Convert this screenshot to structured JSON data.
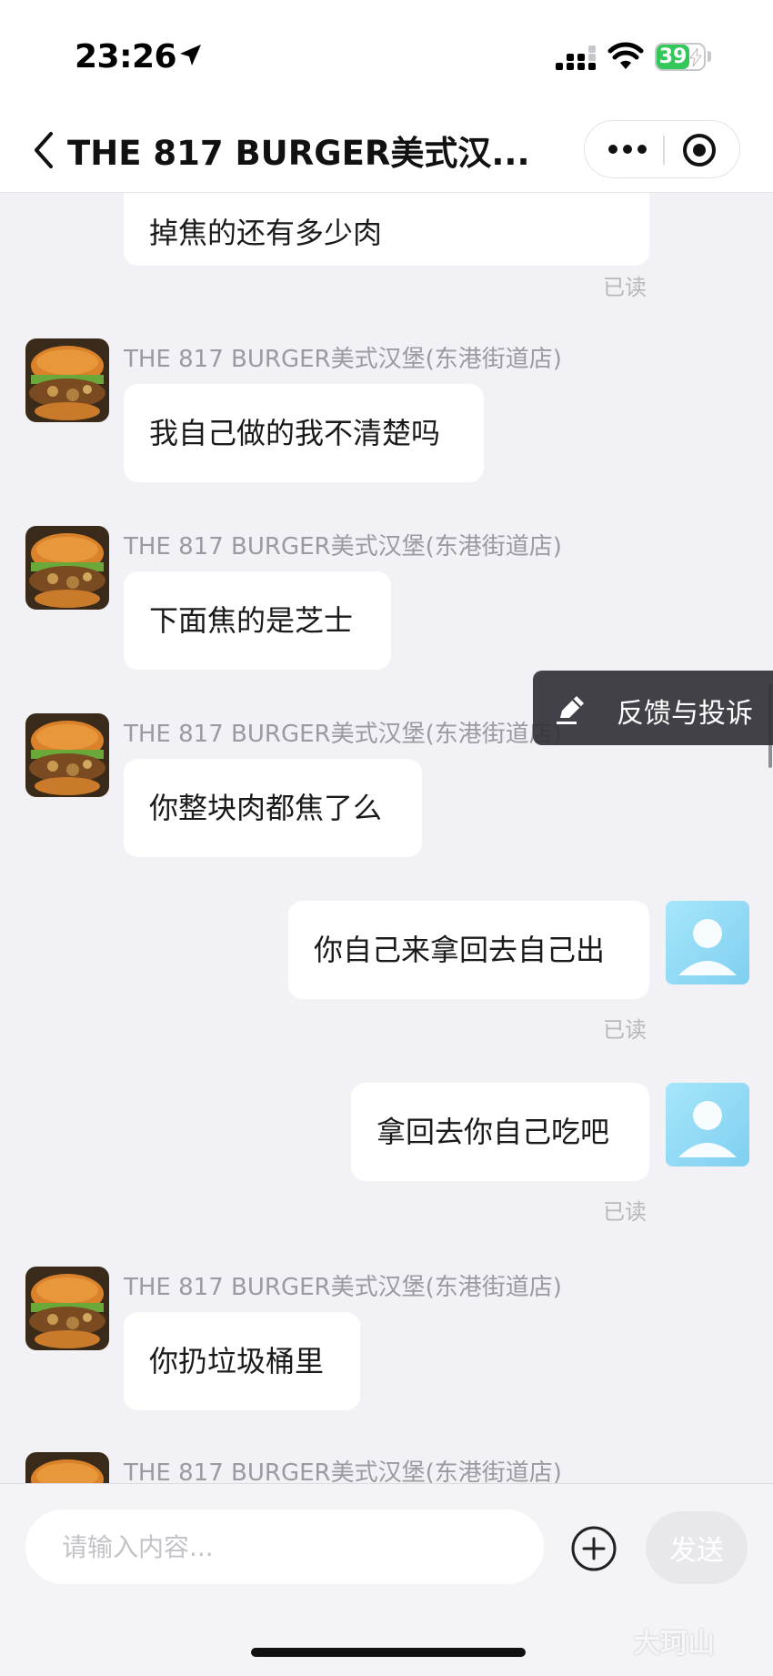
{
  "status": {
    "time": "23:26",
    "battery": "39"
  },
  "nav": {
    "title": "THE 817 BURGER美式汉..."
  },
  "messages": {
    "m0": {
      "text": "掉焦的还有多少肉",
      "read": "已读"
    },
    "m1": {
      "sender": "THE 817 BURGER美式汉堡(东港街道店)",
      "text": "我自己做的我不清楚吗"
    },
    "m2": {
      "sender": "THE 817 BURGER美式汉堡(东港街道店)",
      "text": "下面焦的是芝士"
    },
    "m3": {
      "sender": "THE 817 BURGER美式汉堡(东港街道店)",
      "text": "你整块肉都焦了么"
    },
    "m4": {
      "text": "你自己来拿回去自己出",
      "read": "已读"
    },
    "m5": {
      "text": "拿回去你自己吃吧",
      "read": "已读"
    },
    "m6": {
      "sender": "THE 817 BURGER美式汉堡(东港街道店)",
      "text": "你扔垃圾桶里"
    },
    "m7": {
      "sender": "THE 817 BURGER美式汉堡(东港街道店)"
    }
  },
  "feedback": {
    "label": "反馈与投诉"
  },
  "input": {
    "placeholder": "请输入内容...",
    "send_label": "发送"
  },
  "watermark": "大珂山",
  "colors": {
    "bubble": "#ffffff",
    "background": "#f2f2f6",
    "battery": "#34c759",
    "user_avatar": "#8fd8f5"
  }
}
